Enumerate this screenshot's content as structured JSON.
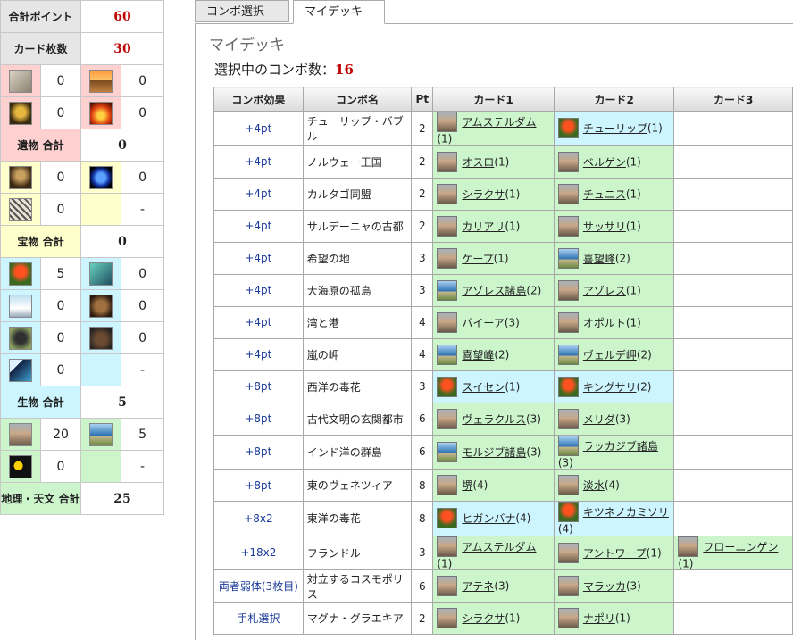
{
  "summary": {
    "total_points_label": "合計ポイント",
    "total_points": "60",
    "card_count_label": "カード枚数",
    "card_count": "30",
    "relic_row1": [
      {
        "icon": "rock-icon",
        "value": "0"
      },
      {
        "icon": "pyramid-icon",
        "value": "0"
      }
    ],
    "relic_row2": [
      {
        "icon": "mask-icon",
        "value": "0"
      },
      {
        "icon": "fire-icon",
        "value": "0"
      }
    ],
    "relic_total_label": "遺物 合計",
    "relic_total": "0",
    "treasure_row1": [
      {
        "icon": "portrait-icon",
        "value": "0"
      },
      {
        "icon": "gem-icon",
        "value": "0"
      }
    ],
    "treasure_row2": [
      {
        "icon": "leopard-icon",
        "value": "0"
      },
      {
        "value": "-"
      }
    ],
    "treasure_total_label": "宝物 合計",
    "treasure_total": "0",
    "creature_row1": [
      {
        "icon": "tulip-icon",
        "value": "5"
      },
      {
        "icon": "butterfly-icon",
        "value": "0"
      }
    ],
    "creature_row2": [
      {
        "icon": "heron-icon",
        "value": "0"
      },
      {
        "icon": "bird-icon",
        "value": "0"
      }
    ],
    "creature_row3": [
      {
        "icon": "gorilla-icon",
        "value": "0"
      },
      {
        "icon": "bear-icon",
        "value": "0"
      }
    ],
    "creature_row4": [
      {
        "icon": "orca-icon",
        "value": "0"
      },
      {
        "value": "-"
      }
    ],
    "creature_total_label": "生物 合計",
    "creature_total": "5",
    "geo_row1": [
      {
        "icon": "city-icon",
        "value": "20"
      },
      {
        "icon": "coast-icon",
        "value": "5"
      }
    ],
    "geo_row2": [
      {
        "icon": "moon-icon",
        "value": "0"
      },
      {
        "value": "-"
      }
    ],
    "geo_total_label": "地理・天文 合計",
    "geo_total": "25"
  },
  "tabs": [
    "コンボ選択",
    "マイデッキ"
  ],
  "panel": {
    "heading": "マイデッキ",
    "selected_label": "選択中のコンボ数：",
    "selected_count": "16"
  },
  "table": {
    "headers": [
      "コンボ効果",
      "コンボ名",
      "Pt",
      "カード1",
      "カード2",
      "カード3"
    ],
    "rows": [
      {
        "effect": "+4pt",
        "name": "チューリップ・バブル",
        "pt": "2",
        "c1": {
          "name": "アムステルダム",
          "count": "(1)",
          "icon": "city"
        },
        "c2": {
          "name": "チューリップ",
          "count": "(1)",
          "icon": "tulip",
          "blue": true
        }
      },
      {
        "effect": "+4pt",
        "name": "ノルウェー王国",
        "pt": "2",
        "c1": {
          "name": "オスロ",
          "count": "(1)",
          "icon": "city"
        },
        "c2": {
          "name": "ベルゲン",
          "count": "(1)",
          "icon": "city"
        }
      },
      {
        "effect": "+4pt",
        "name": "カルタゴ同盟",
        "pt": "2",
        "c1": {
          "name": "シラクサ",
          "count": "(1)",
          "icon": "city"
        },
        "c2": {
          "name": "チュニス",
          "count": "(1)",
          "icon": "city"
        }
      },
      {
        "effect": "+4pt",
        "name": "サルデーニャの古都",
        "pt": "2",
        "c1": {
          "name": "カリアリ",
          "count": "(1)",
          "icon": "city"
        },
        "c2": {
          "name": "サッサリ",
          "count": "(1)",
          "icon": "city"
        }
      },
      {
        "effect": "+4pt",
        "name": "希望の地",
        "pt": "3",
        "c1": {
          "name": "ケープ",
          "count": "(1)",
          "icon": "city"
        },
        "c2": {
          "name": "喜望峰",
          "count": "(2)",
          "icon": "coast"
        }
      },
      {
        "effect": "+4pt",
        "name": "大海原の孤島",
        "pt": "3",
        "c1": {
          "name": "アゾレス諸島",
          "count": "(2)",
          "icon": "coast"
        },
        "c2": {
          "name": "アゾレス",
          "count": "(1)",
          "icon": "city"
        }
      },
      {
        "effect": "+4pt",
        "name": "湾と港",
        "pt": "4",
        "c1": {
          "name": "バイーア",
          "count": "(3)",
          "icon": "city"
        },
        "c2": {
          "name": "オポルト",
          "count": "(1)",
          "icon": "city"
        }
      },
      {
        "effect": "+4pt",
        "name": "嵐の岬",
        "pt": "4",
        "c1": {
          "name": "喜望峰",
          "count": "(2)",
          "icon": "coast"
        },
        "c2": {
          "name": "ヴェルデ岬",
          "count": "(2)",
          "icon": "coast"
        }
      },
      {
        "effect": "+8pt",
        "name": "西洋の毒花",
        "pt": "3",
        "c1": {
          "name": "スイセン",
          "count": "(1)",
          "icon": "tulip",
          "blue": true
        },
        "c2": {
          "name": "キングサリ",
          "count": "(2)",
          "icon": "tulip",
          "blue": true
        }
      },
      {
        "effect": "+8pt",
        "name": "古代文明の玄関都市",
        "pt": "6",
        "c1": {
          "name": "ヴェラクルス",
          "count": "(3)",
          "icon": "city"
        },
        "c2": {
          "name": "メリダ",
          "count": "(3)",
          "icon": "city"
        }
      },
      {
        "effect": "+8pt",
        "name": "インド洋の群島",
        "pt": "6",
        "c1": {
          "name": "モルジブ諸島",
          "count": "(3)",
          "icon": "coast"
        },
        "c2": {
          "name": "ラッカジブ諸島",
          "count": "(3)",
          "icon": "coast"
        }
      },
      {
        "effect": "+8pt",
        "name": "東のヴェネツィア",
        "pt": "8",
        "c1": {
          "name": "堺",
          "count": "(4)",
          "icon": "city"
        },
        "c2": {
          "name": "淡水",
          "count": "(4)",
          "icon": "city"
        }
      },
      {
        "effect": "+8x2",
        "name": "東洋の毒花",
        "pt": "8",
        "c1": {
          "name": "ヒガンバナ",
          "count": "(4)",
          "icon": "tulip",
          "blue": true
        },
        "c2": {
          "name": "キツネノカミソリ",
          "count": "(4)",
          "icon": "tulip",
          "blue": true
        }
      },
      {
        "effect": "+18x2",
        "name": "フランドル",
        "pt": "3",
        "c1": {
          "name": "アムステルダム",
          "count": "(1)",
          "icon": "city"
        },
        "c2": {
          "name": "アントワープ",
          "count": "(1)",
          "icon": "city"
        },
        "c3": {
          "name": "フローニンゲン",
          "count": "(1)",
          "icon": "city"
        }
      },
      {
        "effect": "両者弱体(3枚目)",
        "name": "対立するコスモポリス",
        "pt": "6",
        "c1": {
          "name": "アテネ",
          "count": "(3)",
          "icon": "city"
        },
        "c2": {
          "name": "マラッカ",
          "count": "(3)",
          "icon": "city"
        }
      },
      {
        "effect": "手札選択",
        "name": "マグナ・グラエキア",
        "pt": "2",
        "c1": {
          "name": "シラクサ",
          "count": "(1)",
          "icon": "city"
        },
        "c2": {
          "name": "ナポリ",
          "count": "(1)",
          "icon": "city"
        }
      }
    ]
  }
}
